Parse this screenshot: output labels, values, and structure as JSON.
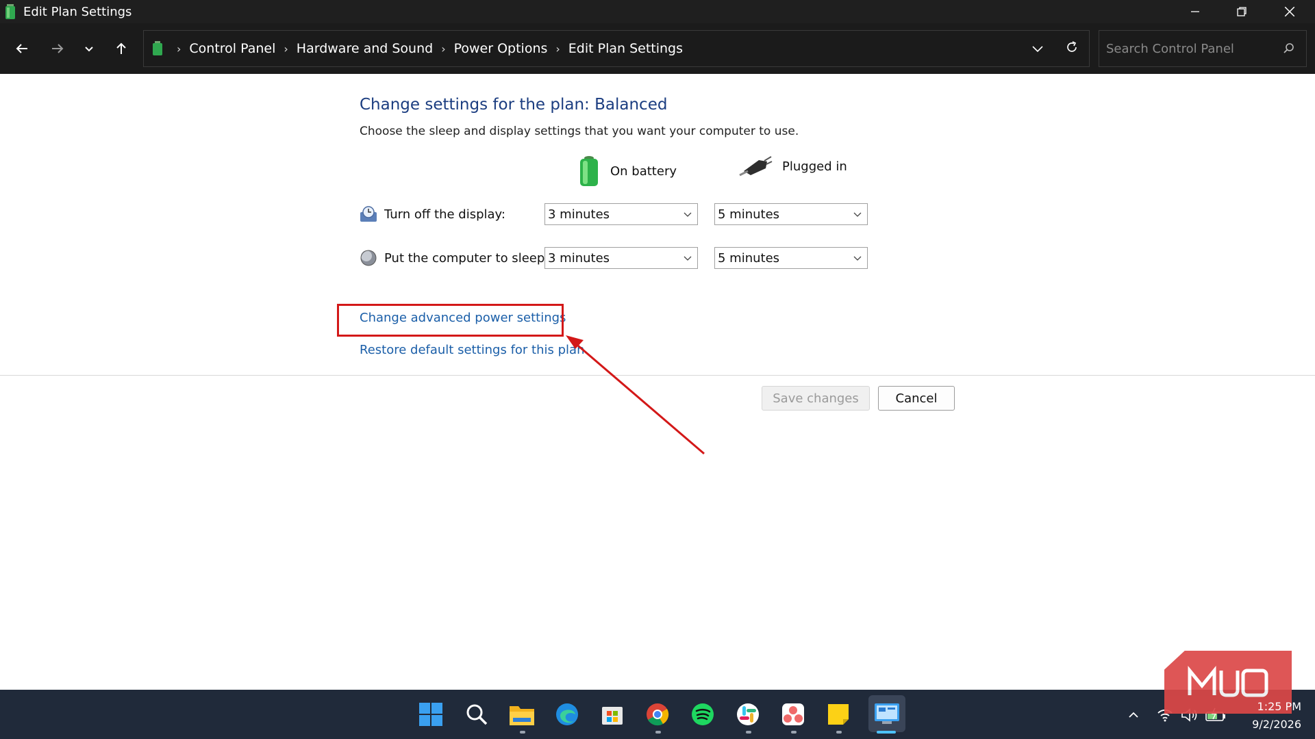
{
  "window": {
    "title": "Edit Plan Settings"
  },
  "address_bar": {
    "breadcrumbs": [
      "Control Panel",
      "Hardware and Sound",
      "Power Options",
      "Edit Plan Settings"
    ],
    "search_placeholder": "Search Control Panel"
  },
  "main": {
    "heading": "Change settings for the plan: Balanced",
    "subtitle": "Choose the sleep and display settings that you want your computer to use.",
    "columns": {
      "battery": "On battery",
      "plugged": "Plugged in"
    },
    "rows": [
      {
        "label": "Turn off the display:",
        "battery_value": "3 minutes",
        "plugged_value": "5 minutes"
      },
      {
        "label": "Put the computer to sleep:",
        "battery_value": "3 minutes",
        "plugged_value": "5 minutes"
      }
    ],
    "links": {
      "advanced": "Change advanced power settings",
      "restore": "Restore default settings for this plan"
    },
    "buttons": {
      "save": "Save changes",
      "cancel": "Cancel"
    }
  },
  "annotation": {
    "highlight_color": "#d31818"
  },
  "taskbar": {
    "apps": [
      "start-icon",
      "search-icon",
      "file-explorer-icon",
      "edge-icon",
      "store-icon",
      "chrome-icon",
      "spotify-icon",
      "slack-icon",
      "asana-icon",
      "sticky-notes-icon",
      "control-panel-icon"
    ],
    "clock": {
      "time": "1:25 PM",
      "date": "9/2/2026"
    }
  },
  "watermark": {
    "text": "MUO"
  },
  "colors": {
    "link": "#1a5ea8",
    "heading": "#1b3d80",
    "titlebar": "#1f1f1f",
    "taskbar": "#202a3a"
  }
}
